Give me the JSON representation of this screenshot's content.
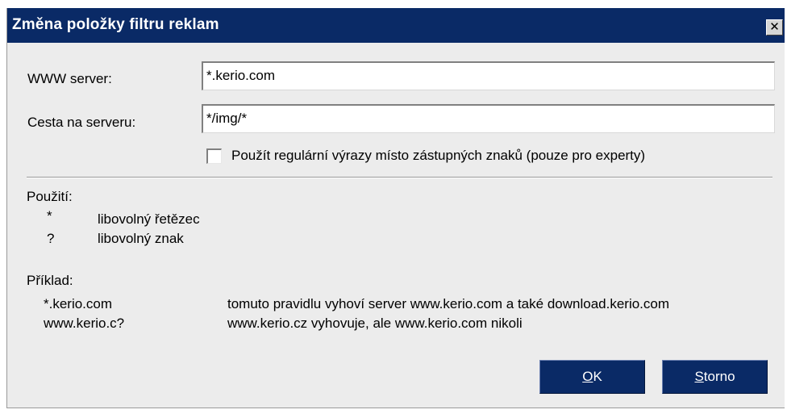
{
  "dialog": {
    "title": "Změna položky filtru reklam",
    "close_glyph": "✕"
  },
  "form": {
    "server_label": "WWW server:",
    "server_value": "*.kerio.com",
    "path_label": "Cesta na serveru:",
    "path_value": "*/img/*",
    "regex_checkbox_label": "Použít regulární výrazy místo zástupných znaků (pouze pro experty)",
    "regex_checked": false
  },
  "usage": {
    "heading": "Použití:",
    "rows": [
      {
        "symbol": "*",
        "desc": "libovolný řetězec"
      },
      {
        "symbol": "?",
        "desc": "libovolný znak"
      }
    ]
  },
  "example": {
    "heading": "Příklad:",
    "rows": [
      {
        "pattern": "*.kerio.com",
        "desc": "tomuto pravidlu vyhoví server www.kerio.com a také download.kerio.com"
      },
      {
        "pattern": "www.kerio.c?",
        "desc": "www.kerio.cz vyhovuje, ale www.kerio.com nikoli"
      }
    ]
  },
  "buttons": {
    "ok_accel": "O",
    "ok_rest": "K",
    "cancel_accel": "S",
    "cancel_rest": "torno"
  },
  "colors": {
    "titlebar": "#0a2a66",
    "dialog_bg": "#ececec",
    "button_bg": "#0a2a66"
  }
}
